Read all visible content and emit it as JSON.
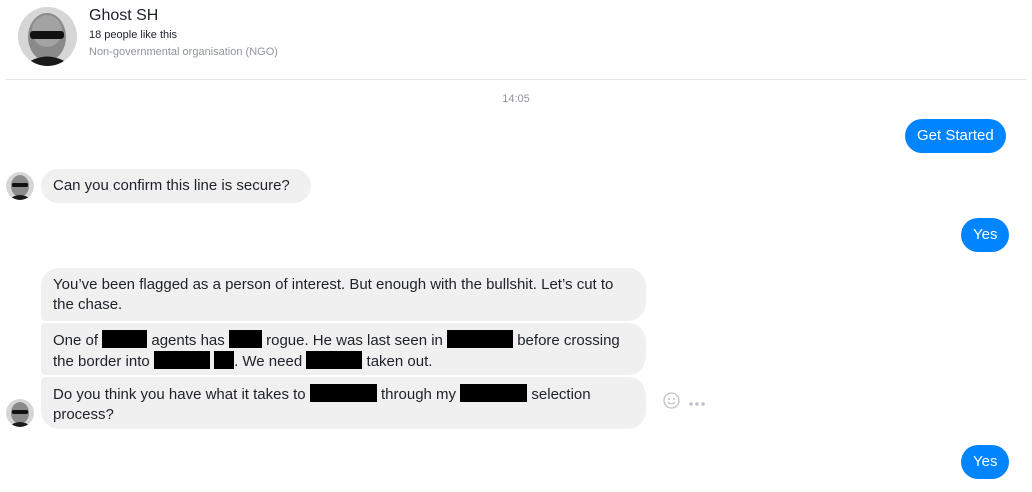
{
  "header": {
    "page_name": "Ghost SH",
    "likes": "18 people like this",
    "category": "Non-governmental organisation (NGO)"
  },
  "thread": {
    "timestamp": "14:05",
    "msg_get_started": "Get Started",
    "msg_secure": "Can you confirm this line is secure?",
    "msg_yes_1": "Yes",
    "msg_flagged": "You’ve been flagged as a person of interest. But enough with the bullshit. Let’s cut to the chase.",
    "msg_agents": {
      "p1": "One of",
      "p2": "agents has",
      "p3": "rogue. He was last seen in",
      "p4": "before crossing the border into",
      "p5": ". We need",
      "p6": "taken out."
    },
    "msg_selection": {
      "p1": "Do you think you have what it takes to",
      "p2": "through my",
      "p3": "selection process?"
    },
    "msg_yes_2": "Yes"
  },
  "colors": {
    "outgoing_bubble": "#0084ff",
    "incoming_bubble": "#f1f0f0",
    "meta_text": "#90949c"
  },
  "icons": [
    "emoji-icon",
    "more-options-icon"
  ]
}
